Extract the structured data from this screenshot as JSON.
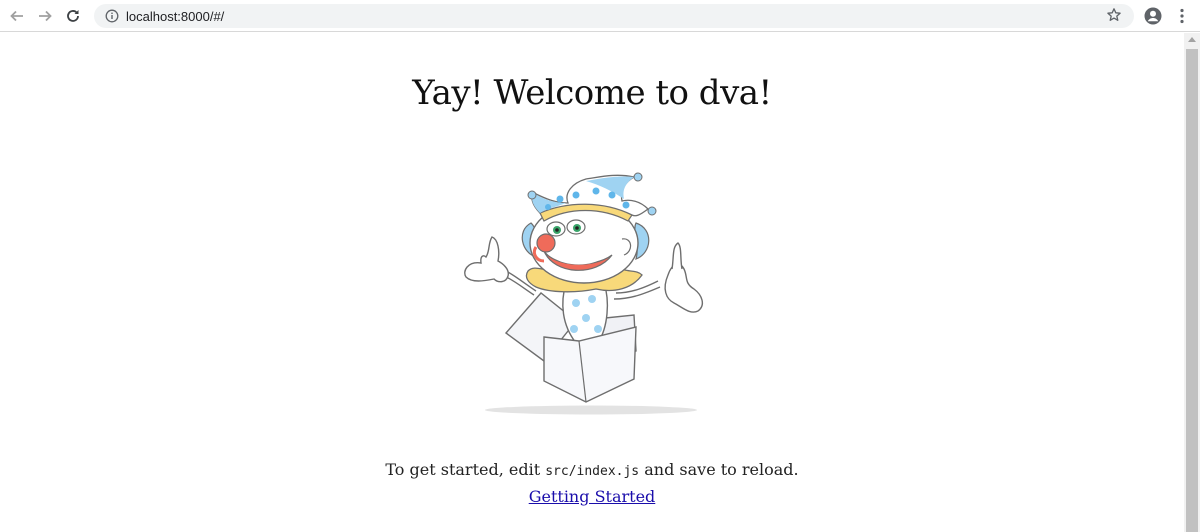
{
  "browser": {
    "url": "localhost:8000/#/",
    "icons": {
      "back": "arrow-left-icon",
      "forward": "arrow-right-icon",
      "reload": "reload-icon",
      "info": "info-icon",
      "bookmark": "star-icon",
      "profile": "account-circle-icon",
      "menu": "more-vert-icon"
    }
  },
  "page": {
    "title": "Yay! Welcome to dva!",
    "intro_prefix": "To get started, edit ",
    "intro_code": "src/index.js",
    "intro_suffix": " and save to reload.",
    "link_label": "Getting Started"
  },
  "colors": {
    "clown_blue": "#9fd3f2",
    "clown_dots": "#5fb6ea",
    "nose": "#ef6b5a",
    "collar": "#f8d97a",
    "eyes": "#3aa56a",
    "link": "#1a0dab"
  }
}
